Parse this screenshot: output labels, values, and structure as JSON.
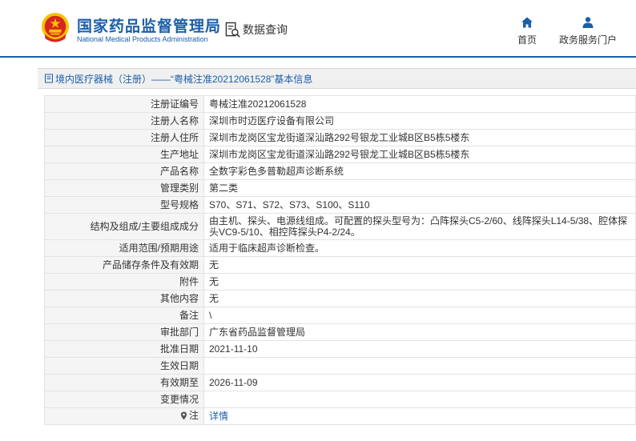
{
  "header": {
    "org_name_cn": "国家药品监督管理局",
    "org_name_en": "National Medical Products Administration",
    "logo_icon": "national-emblem-icon",
    "data_query": {
      "label": "数据查询",
      "icon": "search-document-icon"
    },
    "nav": [
      {
        "label": "首页",
        "icon": "home-icon"
      },
      {
        "label": "政务服务门户",
        "icon": "user-icon"
      }
    ]
  },
  "breadcrumb": {
    "text": "境内医疗器械（注册）——“粤械注准20212061528”基本信息",
    "icon": "document-icon"
  },
  "details": [
    {
      "label": "注册证编号",
      "value": "粤械注准20212061528"
    },
    {
      "label": "注册人名称",
      "value": "深圳市时迈医疗设备有限公司"
    },
    {
      "label": "注册人住所",
      "value": "深圳市龙岗区宝龙街道深汕路292号银龙工业城B区B5栋5楼东"
    },
    {
      "label": "生产地址",
      "value": "深圳市龙岗区宝龙街道深汕路292号银龙工业城B区B5栋5楼东"
    },
    {
      "label": "产品名称",
      "value": "全数字彩色多普勒超声诊断系统"
    },
    {
      "label": "管理类别",
      "value": "第二类"
    },
    {
      "label": "型号规格",
      "value": "S70、S71、S72、S73、S100、S110"
    },
    {
      "label": "结构及组成/主要组成成分",
      "value": "由主机、探头、电源线组成。可配置的探头型号为：凸阵探头C5-2/60、线阵探头L14-5/38、腔体探头VC9-5/10、相控阵探头P4-2/24。"
    },
    {
      "label": "适用范围/预期用途",
      "value": "适用于临床超声诊断检查。"
    },
    {
      "label": "产品储存条件及有效期",
      "value": "无"
    },
    {
      "label": "附件",
      "value": "无"
    },
    {
      "label": "其他内容",
      "value": "无"
    },
    {
      "label": "备注",
      "value": "\\"
    },
    {
      "label": "审批部门",
      "value": "广东省药品监督管理局"
    },
    {
      "label": "批准日期",
      "value": "2021-11-10"
    },
    {
      "label": "生效日期",
      "value": ""
    },
    {
      "label": "有效期至",
      "value": "2026-11-09"
    },
    {
      "label": "变更情况",
      "value": ""
    }
  ],
  "note_row": {
    "label": "注",
    "link": "详情",
    "icon": "pin-icon"
  },
  "colors": {
    "brand_blue": "#1b5fa8",
    "emblem_red": "#d7261f",
    "emblem_gold": "#f5c300"
  }
}
